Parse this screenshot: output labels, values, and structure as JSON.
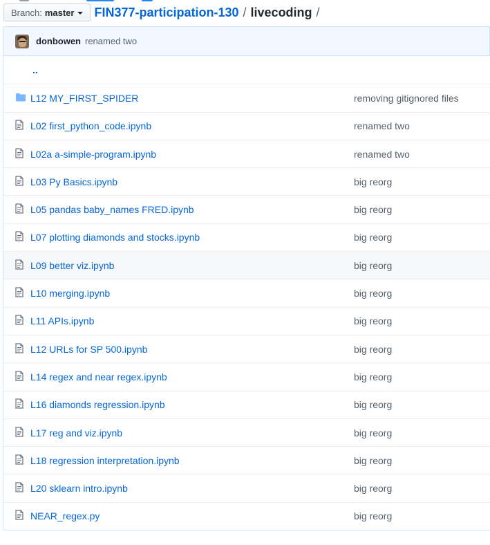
{
  "branch": {
    "label": "Branch:",
    "value": "master"
  },
  "breadcrumb": {
    "repo": "FIN377-participation-130",
    "separator": "/",
    "current": "livecoding",
    "trailing": "/"
  },
  "latest_commit": {
    "author": "donbowen",
    "message": "renamed two"
  },
  "parent_dir": "..",
  "files": [
    {
      "type": "folder",
      "name": "L12 MY_FIRST_SPIDER",
      "commit": "removing gitignored files"
    },
    {
      "type": "file",
      "name": "L02 first_python_code.ipynb",
      "commit": "renamed two"
    },
    {
      "type": "file",
      "name": "L02a a-simple-program.ipynb",
      "commit": "renamed two"
    },
    {
      "type": "file",
      "name": "L03 Py Basics.ipynb",
      "commit": "big reorg"
    },
    {
      "type": "file",
      "name": "L05 pandas baby_names FRED.ipynb",
      "commit": "big reorg"
    },
    {
      "type": "file",
      "name": "L07 plotting diamonds and stocks.ipynb",
      "commit": "big reorg"
    },
    {
      "type": "file",
      "name": "L09 better viz.ipynb",
      "commit": "big reorg",
      "hover": true
    },
    {
      "type": "file",
      "name": "L10 merging.ipynb",
      "commit": "big reorg"
    },
    {
      "type": "file",
      "name": "L11 APIs.ipynb",
      "commit": "big reorg"
    },
    {
      "type": "file",
      "name": "L12 URLs for SP 500.ipynb",
      "commit": "big reorg"
    },
    {
      "type": "file",
      "name": "L14 regex and near regex.ipynb",
      "commit": "big reorg"
    },
    {
      "type": "file",
      "name": "L16 diamonds regression.ipynb",
      "commit": "big reorg"
    },
    {
      "type": "file",
      "name": "L17 reg and viz.ipynb",
      "commit": "big reorg"
    },
    {
      "type": "file",
      "name": "L18 regression interpretation.ipynb",
      "commit": "big reorg"
    },
    {
      "type": "file",
      "name": "L20 sklearn intro.ipynb",
      "commit": "big reorg"
    },
    {
      "type": "file",
      "name": "NEAR_regex.py",
      "commit": "big reorg"
    }
  ],
  "colors": {
    "link": "#0366d6",
    "muted": "#586069",
    "icon": "#6a737d",
    "folder": "#79b8ff",
    "commit_bg": "#f1f8ff"
  }
}
